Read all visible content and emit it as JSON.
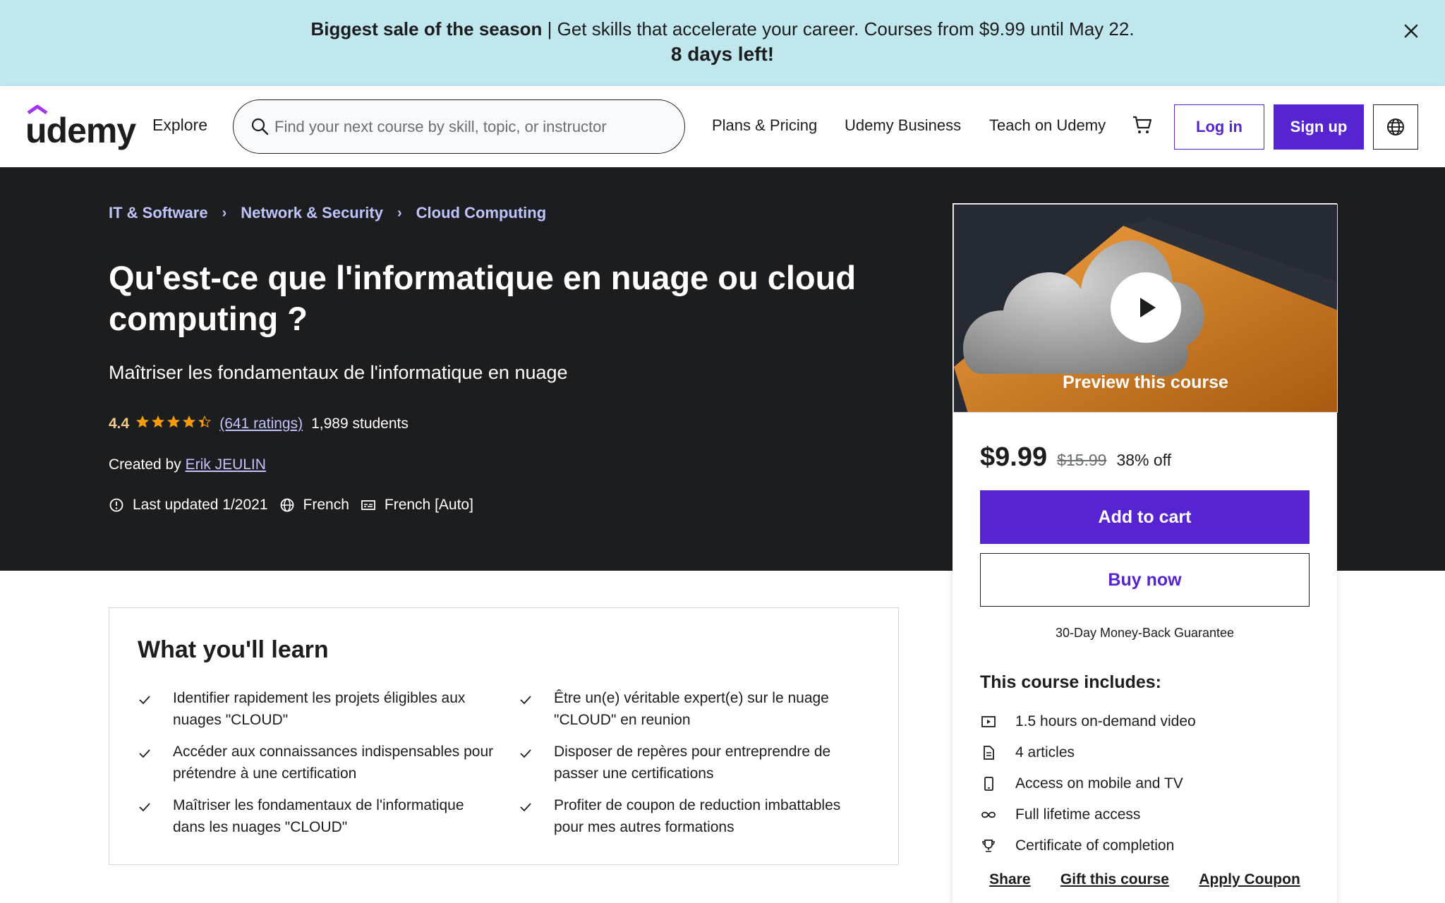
{
  "banner": {
    "bold": "Biggest sale of the season",
    "text": " | Get skills that accelerate your career. Courses from $9.99 until May 22.",
    "line2": "8 days left!"
  },
  "header": {
    "logo": "udemy",
    "explore": "Explore",
    "search_placeholder": "Find your next course by skill, topic, or instructor",
    "plans": "Plans & Pricing",
    "business": "Udemy Business",
    "teach": "Teach on Udemy",
    "login": "Log in",
    "signup": "Sign up"
  },
  "breadcrumb": [
    "IT & Software",
    "Network & Security",
    "Cloud Computing"
  ],
  "course": {
    "title": "Qu'est-ce que l'informatique en nuage ou cloud computing ?",
    "subtitle": "Maîtriser les fondamentaux de l'informatique en nuage",
    "rating": "4.4",
    "rating_value": 4.4,
    "ratings_count": "(641 ratings)",
    "students": "1,989 students",
    "created_by": "Created by ",
    "instructor": "Erik JEULIN",
    "updated": "Last updated 1/2021",
    "language": "French",
    "captions": "French [Auto]"
  },
  "card": {
    "preview": "Preview this course",
    "price": "$9.99",
    "old_price": "$15.99",
    "discount": "38% off",
    "add_to_cart": "Add to cart",
    "buy_now": "Buy now",
    "guarantee": "30-Day Money-Back Guarantee",
    "includes_title": "This course includes:",
    "includes": [
      {
        "icon": "video-icon",
        "text": "1.5 hours on-demand video"
      },
      {
        "icon": "article-icon",
        "text": "4 articles"
      },
      {
        "icon": "mobile-icon",
        "text": "Access on mobile and TV"
      },
      {
        "icon": "infinity-icon",
        "text": "Full lifetime access"
      },
      {
        "icon": "trophy-icon",
        "text": "Certificate of completion"
      }
    ],
    "links": [
      "Share",
      "Gift this course",
      "Apply Coupon"
    ]
  },
  "learn": {
    "title": "What you'll learn",
    "items": [
      "Identifier rapidement les projets éligibles aux nuages \"CLOUD\"",
      "Être un(e) véritable expert(e) sur le nuage \"CLOUD\" en reunion",
      "Accéder aux connaissances indispensables pour prétendre à une certification",
      "Disposer de repères pour entreprendre de passer une certifications",
      "Maîtriser les fondamentaux de l'informatique dans les nuages \"CLOUD\"",
      "Profiter de coupon de reduction imbattables pour mes autres formations"
    ]
  },
  "colors": {
    "brand": "#5624d0",
    "banner_bg": "#c0e6ee",
    "hero_bg": "#1c1d1f",
    "link_light": "#c0c4fc",
    "rating": "#f3ca8c",
    "star": "#f69c08"
  }
}
